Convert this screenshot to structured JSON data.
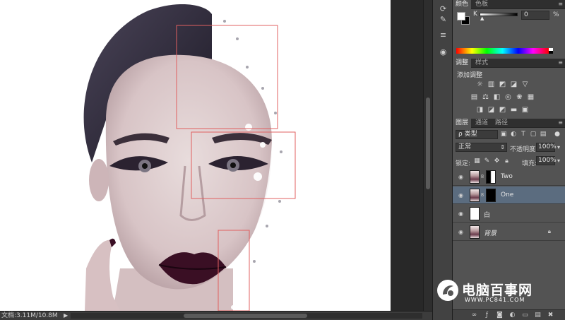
{
  "status": {
    "doc_info": "文档:3.11M/10.8M",
    "arrow": "▶"
  },
  "color_panel": {
    "tabs": [
      "颜色",
      "色板"
    ],
    "channel_label": "K",
    "channel_value": "0",
    "unit": "%"
  },
  "adjust_panel": {
    "tabs": [
      "调整",
      "样式"
    ],
    "heading": "添加调整"
  },
  "layers_panel": {
    "tabs": [
      "图层",
      "通道",
      "路径"
    ],
    "filter_label": "ρ 类型",
    "blend_mode": "正常",
    "opacity_label": "不透明度:",
    "opacity_value": "100%",
    "lock_label": "锁定:",
    "fill_label": "填充:",
    "fill_value": "100%",
    "layers": [
      {
        "name": "Two",
        "selected": false
      },
      {
        "name": "One",
        "selected": true
      },
      {
        "name": "白",
        "selected": false
      },
      {
        "name": "背景",
        "selected": false
      }
    ]
  },
  "watermark": {
    "title": "电脑百事网",
    "url": "WWW.PC841.COM"
  },
  "colors": {
    "selection_bg": "#5b6c7f",
    "guide_box": "#e06060",
    "lips": "#3a0f24"
  },
  "icons": {
    "tool_strip": [
      "3d-rotate-icon",
      "brush-icon",
      "adjust-icon",
      "channels-icon"
    ],
    "visibility": "eye-icon",
    "footer": [
      "link-icon",
      "fx-icon",
      "mask-icon",
      "adjustment-layer-icon",
      "group-icon",
      "new-layer-icon",
      "trash-icon"
    ]
  }
}
